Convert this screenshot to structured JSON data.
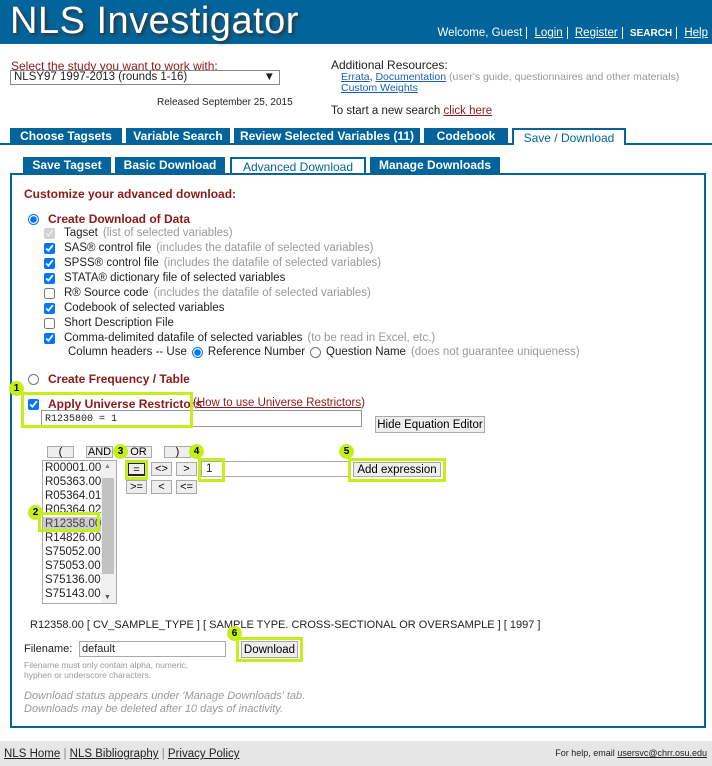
{
  "header": {
    "title": "NLS Investigator",
    "welcome": "Welcome, Guest",
    "login": "Login",
    "register": "Register",
    "search": "SEARCH",
    "help": "Help"
  },
  "study": {
    "label": "Select the study you want to work with:",
    "selected": "NLSY97 1997-2013 (rounds 1-16)",
    "released": "Released September 25, 2015"
  },
  "resources": {
    "title": "Additional Resources:",
    "errata": "Errata",
    "documentation": "Documentation",
    "doc_note": "(user's guide, questionnaires and other materials)",
    "weights": "Custom Weights",
    "new_search": "To start a new search",
    "click_here": "click here"
  },
  "main_tabs": [
    "Choose Tagsets",
    "Variable Search",
    "Review Selected Variables (11)",
    "Codebook",
    "Save / Download"
  ],
  "sub_tabs": [
    "Save Tagset",
    "Basic Download",
    "Advanced Download",
    "Manage Downloads"
  ],
  "content": {
    "heading": "Customize your advanced download:",
    "create_download": "Create Download of Data",
    "options": [
      {
        "label": "Tagset",
        "note": "(list of selected variables)",
        "checked": true,
        "disabled": true
      },
      {
        "label": "SAS® control file",
        "note": "(includes the datafile of selected variables)",
        "checked": true
      },
      {
        "label": "SPSS® control file",
        "note": "(includes the datafile of selected variables)",
        "checked": true
      },
      {
        "label": "STATA® dictionary file of selected variables",
        "note": "",
        "checked": true
      },
      {
        "label": "R® Source code",
        "note": "(includes the datafile of selected variables)",
        "checked": false
      },
      {
        "label": "Codebook of selected variables",
        "note": "",
        "checked": true
      },
      {
        "label": "Short Description File",
        "note": "",
        "checked": false
      },
      {
        "label": "Comma-delimited datafile of selected variables",
        "note": "(to be read in Excel, etc.)",
        "checked": true
      }
    ],
    "column_headers": "Column headers -- Use",
    "ref_number": "Reference Number",
    "question_name": "Question Name",
    "question_note": "(does not guarantee uniqueness)",
    "create_freq": "Create Frequency / Table",
    "apply_restrictors": "Apply Universe Restrictors",
    "how_to": "How to use Universe Restrictors",
    "equation": "R1235800 = 1",
    "hide_editor": "Hide Equation Editor",
    "ops_top": [
      "(",
      "AND",
      "OR",
      ")"
    ],
    "ops": [
      "=",
      "<>",
      ">",
      ">=",
      "<",
      "<="
    ],
    "value": "1",
    "add_expression": "Add expression",
    "variables": [
      "R00001.00",
      "R05363.00",
      "R05364.01",
      "R05364.02",
      "R12358.00",
      "R14826.00",
      "S75052.00",
      "S75053.00",
      "S75136.00",
      "S75143.00"
    ],
    "selected_variable": "R12358.00",
    "var_description": "R12358.00 [ CV_SAMPLE_TYPE ] [ SAMPLE TYPE. CROSS-SECTIONAL OR OVERSAMPLE ] [ 1997 ]",
    "filename_label": "Filename:",
    "filename": "default",
    "download": "Download",
    "filename_note1": "Filename must only contain alpha, numeric,",
    "filename_note2": "hyphen or underscore characters.",
    "status1": "Download status appears under 'Manage Downloads' tab.",
    "status2": "Downloads may be deleted after 10 days of inactivity."
  },
  "badges": [
    "1",
    "2",
    "3",
    "4",
    "5",
    "6"
  ],
  "highlight_color": "#c4ef1a",
  "footer": {
    "links": [
      "NLS Home",
      "NLS Bibliography",
      "Privacy Policy"
    ],
    "help_text": "For help, email",
    "email": "usersvc@chrr.osu.edu"
  }
}
